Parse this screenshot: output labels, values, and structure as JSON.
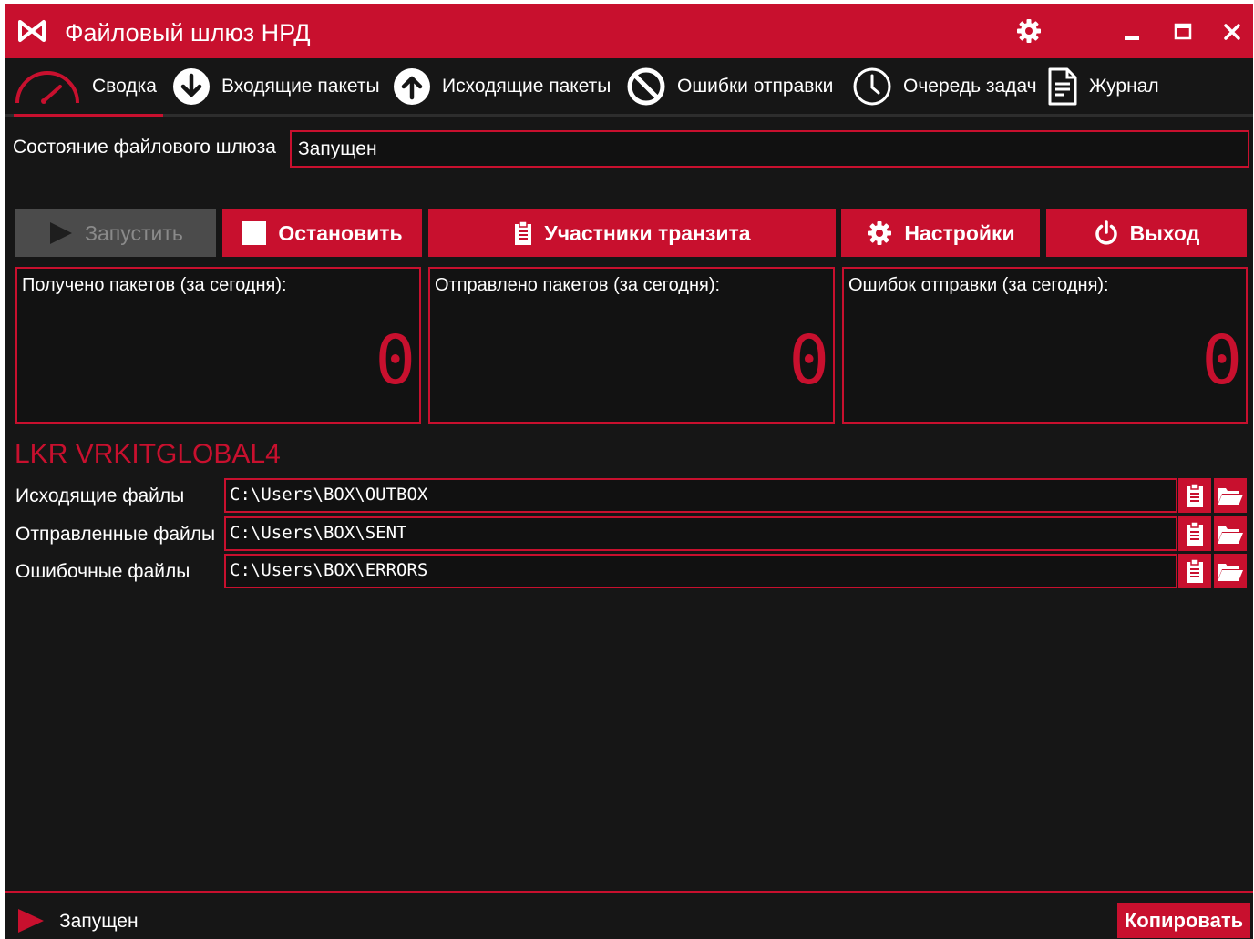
{
  "window": {
    "title": "Файловый шлюз НРД"
  },
  "nav": {
    "tabs": [
      {
        "label": "Сводка",
        "icon": "gauge-icon",
        "active": true
      },
      {
        "label": "Входящие пакеты",
        "icon": "arrow-down-circle-icon"
      },
      {
        "label": "Исходящие пакеты",
        "icon": "arrow-up-circle-icon"
      },
      {
        "label": "Ошибки отправки",
        "icon": "no-entry-icon"
      },
      {
        "label": "Очередь задач",
        "icon": "clock-icon"
      },
      {
        "label": "Журнал",
        "icon": "document-icon"
      }
    ]
  },
  "state": {
    "label": "Состояние файлового шлюза",
    "value": "Запущен"
  },
  "actions": {
    "start": "Запустить",
    "stop": "Остановить",
    "participants": "Участники транзита",
    "settings": "Настройки",
    "exit": "Выход"
  },
  "stats": [
    {
      "label": "Получено пакетов (за сегодня):",
      "value": "0"
    },
    {
      "label": "Отправлено пакетов (за сегодня):",
      "value": "0"
    },
    {
      "label": "Ошибок отправки (за сегодня):",
      "value": "0"
    }
  ],
  "section": {
    "title": "LKR VRKITGLOBAL4"
  },
  "paths": [
    {
      "label": "Исходящие файлы",
      "value": "C:\\Users\\BOX\\OUTBOX"
    },
    {
      "label": "Отправленные файлы",
      "value": "C:\\Users\\BOX\\SENT"
    },
    {
      "label": "Ошибочные файлы",
      "value": "C:\\Users\\BOX\\ERRORS"
    }
  ],
  "status": {
    "text": "Запущен",
    "copy_label": "Копировать"
  },
  "colors": {
    "accent": "#c8102e",
    "background": "#161616",
    "disabled": "#4b4b4b"
  }
}
